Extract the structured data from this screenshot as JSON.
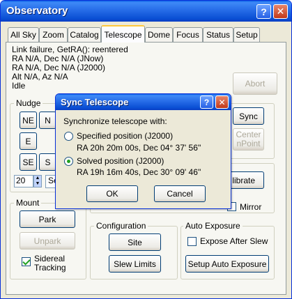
{
  "window": {
    "title": "Observatory"
  },
  "tabs": [
    {
      "label": "All Sky"
    },
    {
      "label": "Zoom"
    },
    {
      "label": "Catalog"
    },
    {
      "label": "Telescope"
    },
    {
      "label": "Dome"
    },
    {
      "label": "Focus"
    },
    {
      "label": "Status"
    },
    {
      "label": "Setup"
    }
  ],
  "status_log": [
    "Link failure, GetRA(): reentered",
    "RA N/A, Dec N/A (JNow)",
    "RA N/A, Dec N/A (J2000)",
    "Alt N/A, Az N/A",
    "Idle"
  ],
  "abort_label": "Abort",
  "nudge": {
    "label": "Nudge",
    "ne": "NE",
    "n": "N",
    "e": "E",
    "se": "SE",
    "s": "S",
    "step_value": "20",
    "partial_text": "Se"
  },
  "sync": {
    "button_label": "Sync",
    "center_label_1": "Center",
    "center_label_2": "nPoint"
  },
  "calibrate_label": "librate",
  "mirror_label": "Mirror",
  "mount": {
    "label": "Mount",
    "park": "Park",
    "unpark": "Unpark",
    "sidereal_tracking_1": "Sidereal",
    "sidereal_tracking_2": "Tracking",
    "sidereal_checked": true
  },
  "configuration": {
    "label": "Configuration",
    "site": "Site",
    "slew_limits": "Slew Limits"
  },
  "auto_exposure": {
    "label": "Auto Exposure",
    "expose_after_slew": "Expose After Slew",
    "setup": "Setup Auto Exposure"
  },
  "dialog": {
    "title": "Sync Telescope",
    "prompt": "Synchronize telescope with:",
    "option1_label": "Specified position (J2000)",
    "option1_coords": "RA 20h 20m 00s, Dec 04° 37' 56''",
    "option2_label": "Solved position (J2000)",
    "option2_coords": "RA 19h 16m 40s, Dec 30° 09' 46''",
    "ok": "OK",
    "cancel": "Cancel",
    "help": "?",
    "close": "✕"
  },
  "window_buttons": {
    "help": "?",
    "close": "✕"
  }
}
